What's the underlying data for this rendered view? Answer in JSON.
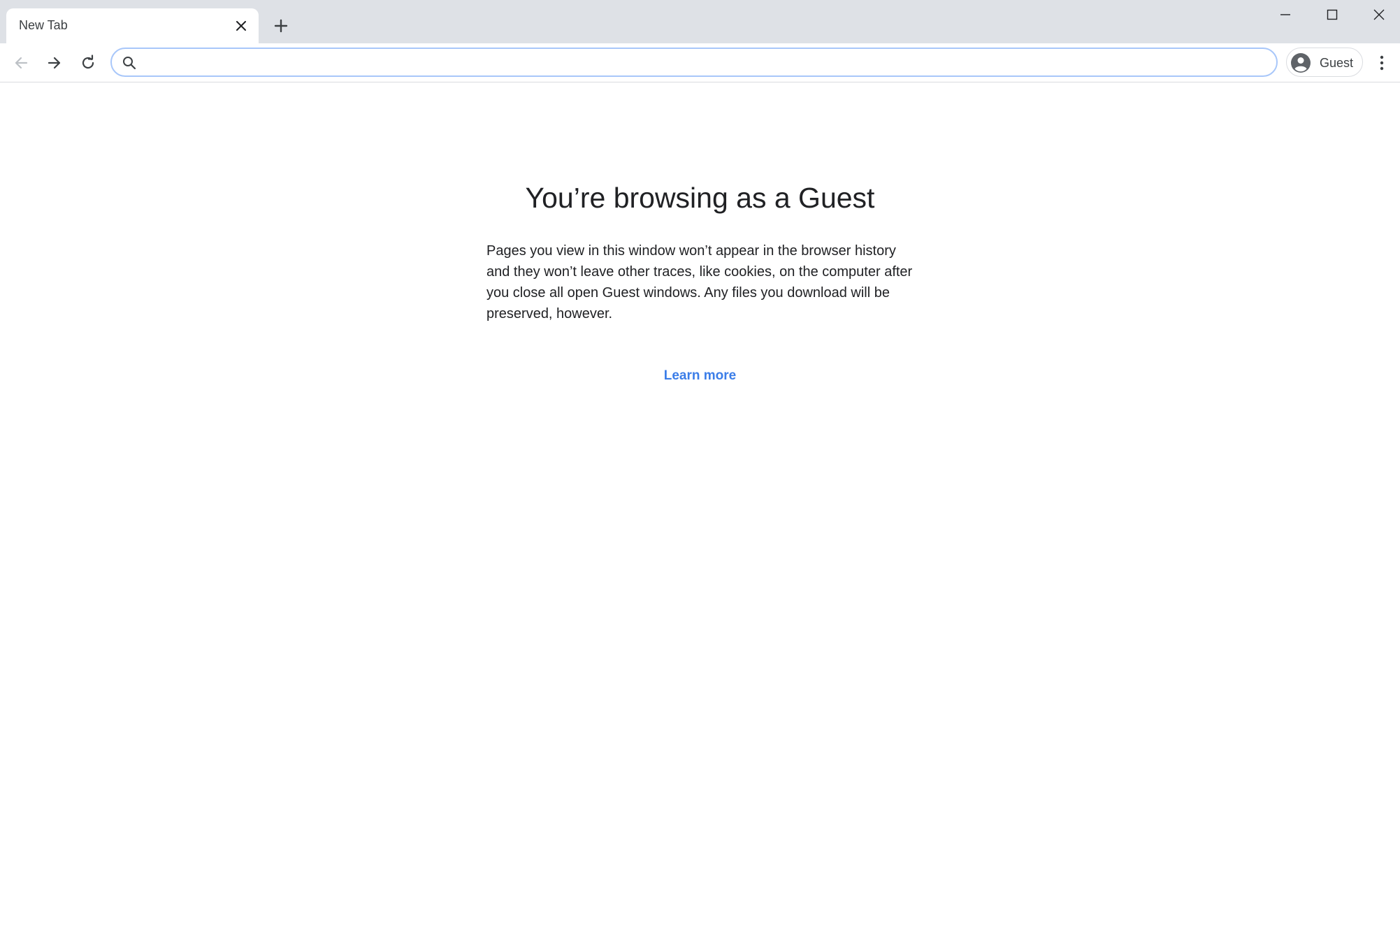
{
  "tabs": [
    {
      "title": "New Tab"
    }
  ],
  "omnibox": {
    "value": "",
    "placeholder": ""
  },
  "profile": {
    "label": "Guest"
  },
  "page": {
    "heading": "You’re browsing as a Guest",
    "body": "Pages you view in this window won’t appear in the browser history and they won’t leave other traces, like cookies, on the computer after you close all open Guest windows. Any files you download will be preserved, however.",
    "link": "Learn more"
  },
  "icons": {
    "tab_close": "close-icon",
    "new_tab": "plus-icon",
    "minimize": "minimize-icon",
    "maximize": "maximize-icon",
    "window_close": "close-icon",
    "back": "arrow-left-icon",
    "forward": "arrow-right-icon",
    "reload": "reload-icon",
    "search": "search-icon",
    "avatar": "avatar-icon",
    "menu": "more-vert-icon"
  },
  "colors": {
    "tabstrip": "#dee1e6",
    "omnibox_border": "#a8c7fa",
    "link": "#3b7de8",
    "icon": "#5f6368",
    "icon_disabled": "#bdc1c6"
  }
}
